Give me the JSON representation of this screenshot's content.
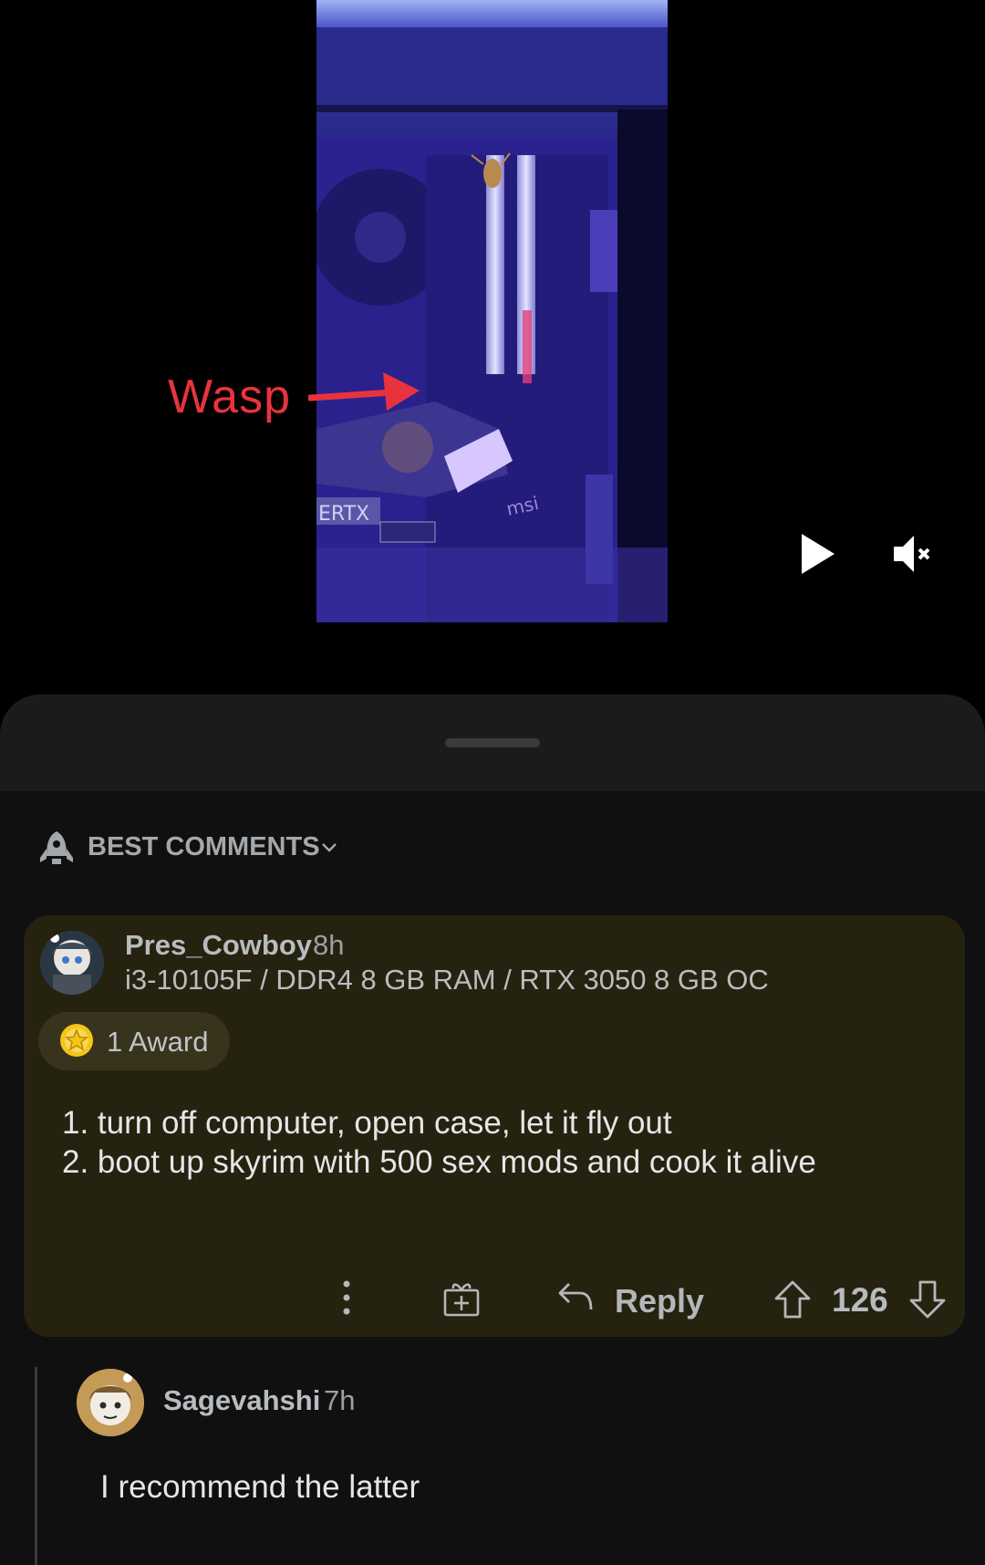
{
  "media": {
    "annotation_label": "Wasp"
  },
  "sheet": {
    "sort_label": "BEST COMMENTS"
  },
  "comments": [
    {
      "author": "Pres_Cowboy",
      "age": "8h",
      "flair": "i3-10105F / DDR4 8 GB RAM / RTX 3050 8 GB OC",
      "award": "1 Award",
      "body_lines": [
        "1. turn off computer, open case, let it fly out",
        "2. boot up skyrim with 500 sex mods and cook it alive"
      ],
      "actions": {
        "reply_label": "Reply",
        "score": "126"
      }
    },
    {
      "author": "Sagevahshi",
      "age": "7h",
      "body": "I recommend the latter"
    }
  ],
  "colors": {
    "annotation_red": "#e8333f",
    "comment_highlight_bg": "#25220f",
    "award_gold": "#f5c518"
  }
}
